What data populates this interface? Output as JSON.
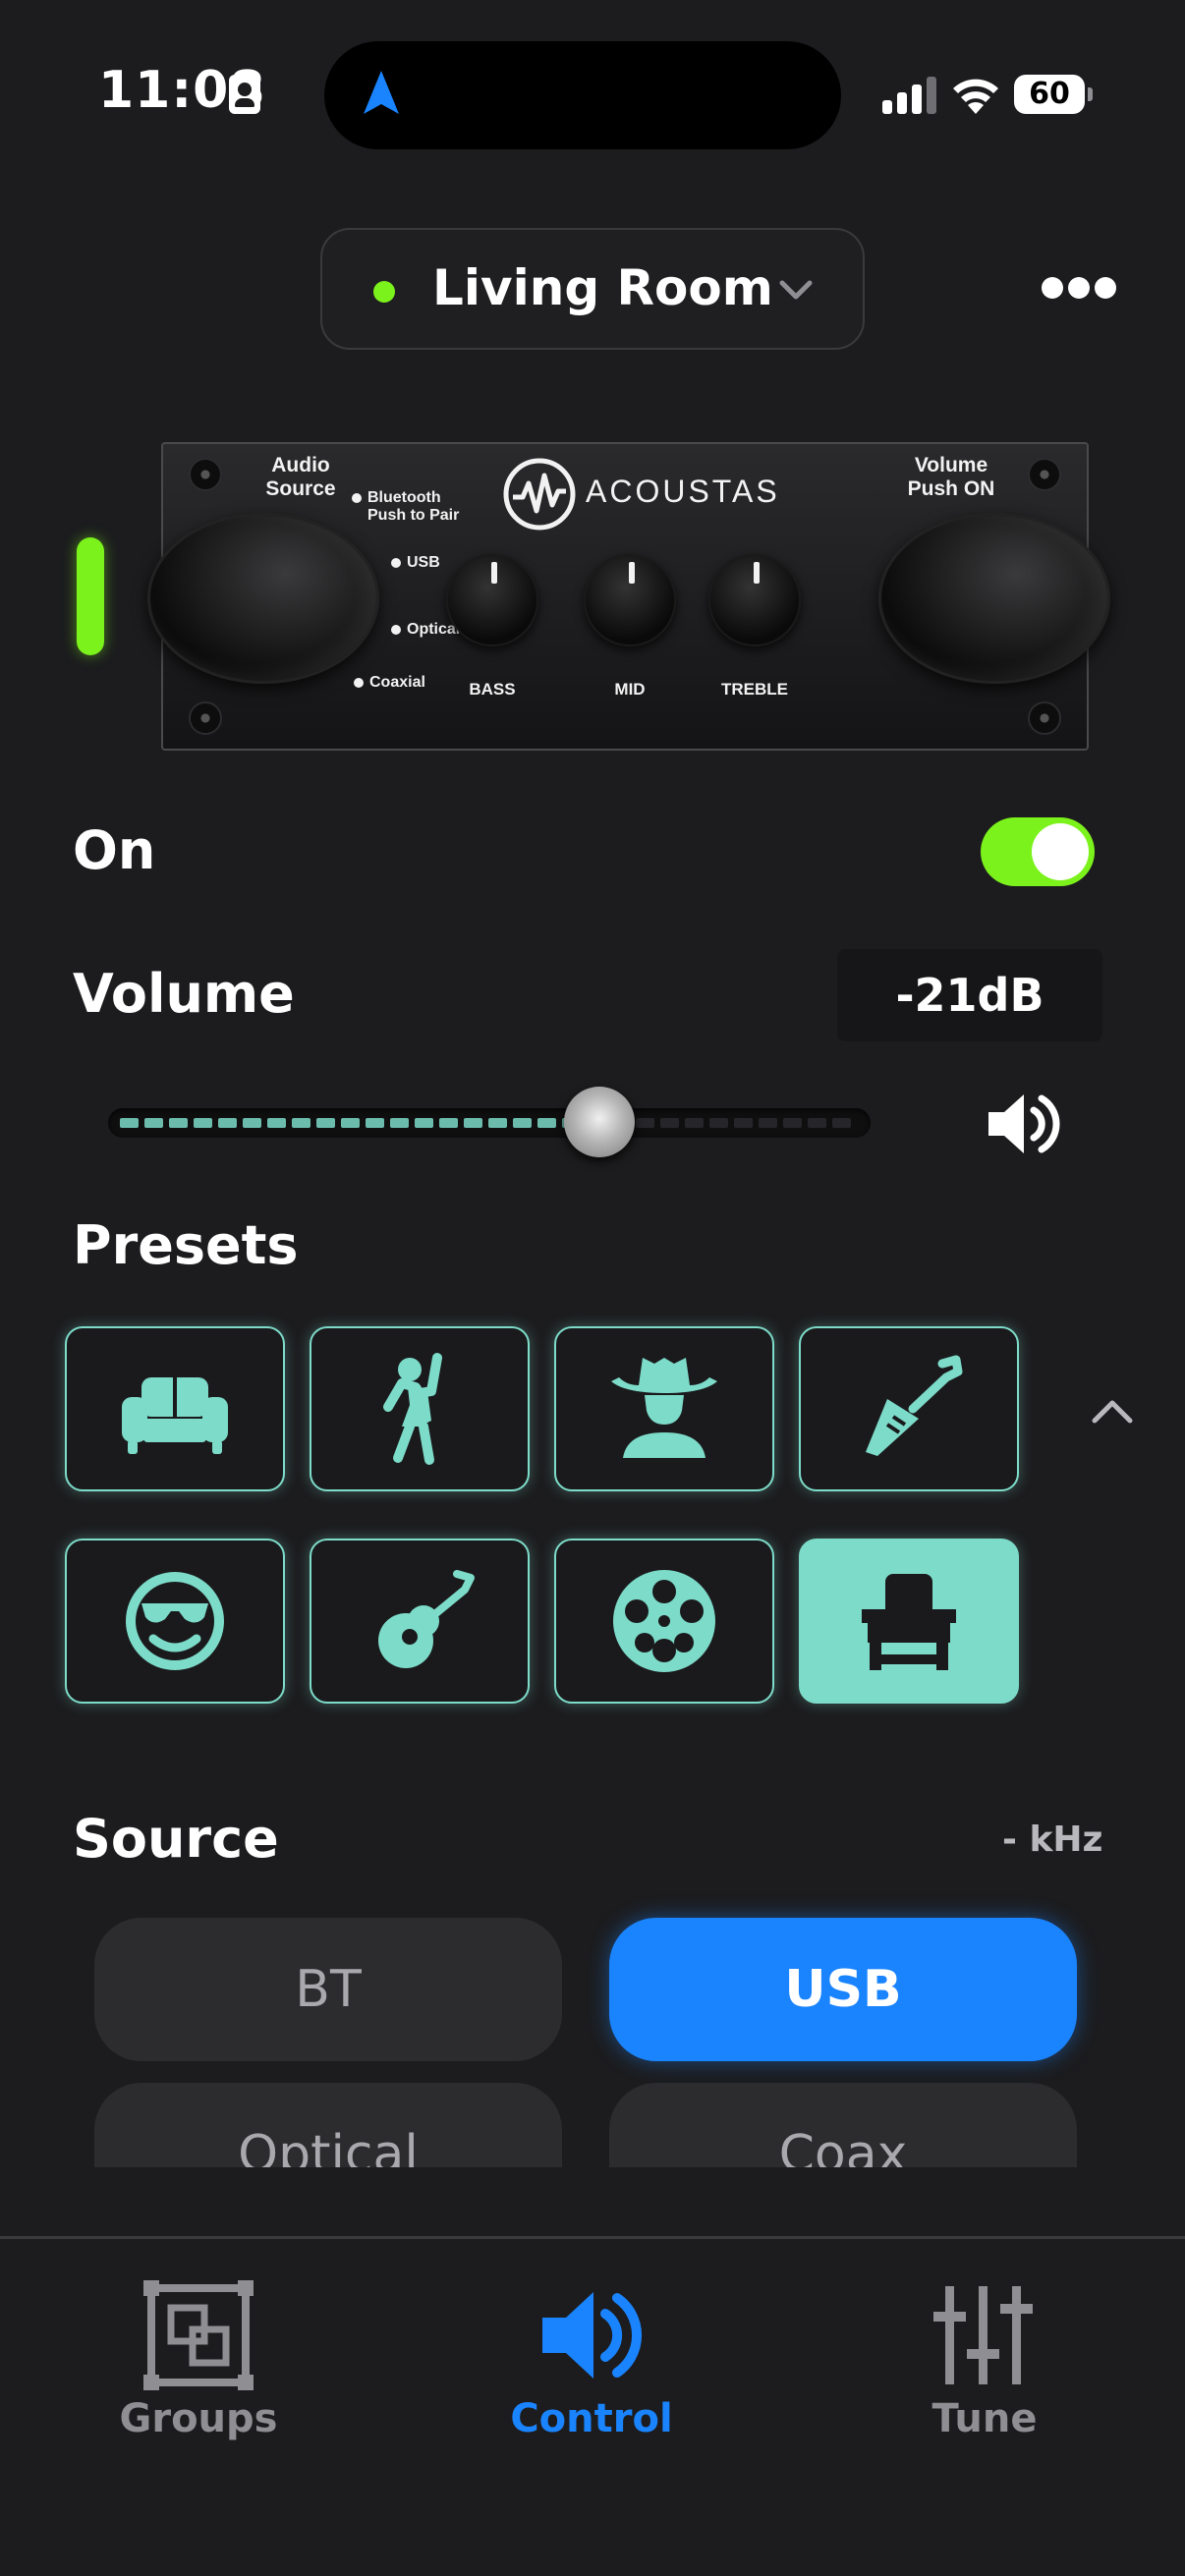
{
  "status_bar": {
    "time": "11:08",
    "battery": "60"
  },
  "header": {
    "room_name": "Living Room",
    "room_status_color": "#7cf21c"
  },
  "device_panel": {
    "brand": "ACOUSTAS",
    "left_knob_label": [
      "Audio",
      "Source"
    ],
    "right_knob_label": [
      "Volume",
      "Push ON"
    ],
    "sources": [
      "Bluetooth",
      "Push to Pair",
      "USB",
      "Optical",
      "Coaxial"
    ],
    "tone_knobs": [
      "BASS",
      "MID",
      "TREBLE"
    ]
  },
  "power": {
    "label": "On",
    "on": true
  },
  "volume": {
    "label": "Volume",
    "value": "-21dB",
    "level_fraction": 0.64
  },
  "presets": {
    "label": "Presets",
    "items": [
      {
        "icon": "couch-icon",
        "selected": false
      },
      {
        "icon": "dancing-person-icon",
        "selected": false
      },
      {
        "icon": "cowboy-icon",
        "selected": false
      },
      {
        "icon": "electric-guitar-icon",
        "selected": false
      },
      {
        "icon": "sunglasses-smiley-icon",
        "selected": false
      },
      {
        "icon": "acoustic-guitar-icon",
        "selected": false
      },
      {
        "icon": "film-reel-icon",
        "selected": false
      },
      {
        "icon": "armchair-icon",
        "selected": true
      }
    ]
  },
  "source": {
    "label": "Source",
    "sample_rate": "- kHz",
    "options": [
      "BT",
      "USB",
      "Optical",
      "Coax"
    ],
    "selected": "USB"
  },
  "tab_bar": {
    "tabs": [
      {
        "label": "Groups",
        "icon": "groups-icon",
        "active": false
      },
      {
        "label": "Control",
        "icon": "speaker-icon",
        "active": true
      },
      {
        "label": "Tune",
        "icon": "sliders-icon",
        "active": false
      }
    ]
  },
  "colors": {
    "accent_green": "#7cf21c",
    "accent_teal": "#7ddbc9",
    "accent_blue": "#1a84ff",
    "background": "#1c1c1e"
  }
}
